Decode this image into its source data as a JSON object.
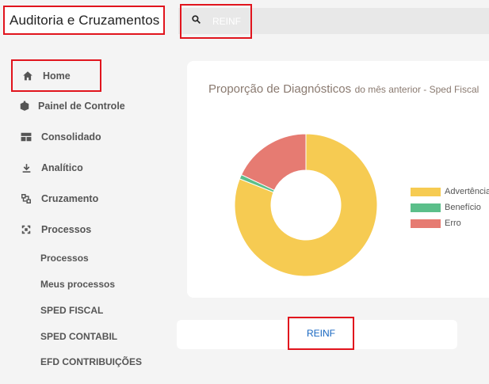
{
  "header": {
    "title": "Auditoria e Cruzamentos",
    "search": {
      "placeholder": "REINF",
      "value": ""
    }
  },
  "sidebar": {
    "items": [
      {
        "label": "Home",
        "icon": "home-icon"
      },
      {
        "label": "Painel de Controle",
        "icon": "dashboard-icon"
      },
      {
        "label": "Consolidado",
        "icon": "table-icon"
      },
      {
        "label": "Analítico",
        "icon": "download-icon"
      },
      {
        "label": "Cruzamento",
        "icon": "merge-icon"
      },
      {
        "label": "Processos",
        "icon": "process-icon"
      }
    ],
    "subitems": [
      "Processos",
      "Meus processos",
      "SPED FISCAL",
      "SPED CONTABIL",
      "EFD CONTRIBUIÇÕES"
    ]
  },
  "card": {
    "title": "Proporção de Diagnósticos",
    "subtitle": "do mês anterior - Sped Fiscal"
  },
  "chart_data": {
    "type": "pie",
    "title": "Proporção de Diagnósticos do mês anterior - Sped Fiscal",
    "series": [
      {
        "name": "Advertência",
        "value": 81,
        "color": "#f6cb52"
      },
      {
        "name": "Benefício",
        "value": 1,
        "color": "#5bbf8a"
      },
      {
        "name": "Erro",
        "value": 18,
        "color": "#e67b72"
      }
    ],
    "legend": "right"
  },
  "bottom": {
    "button_label": "REINF"
  }
}
